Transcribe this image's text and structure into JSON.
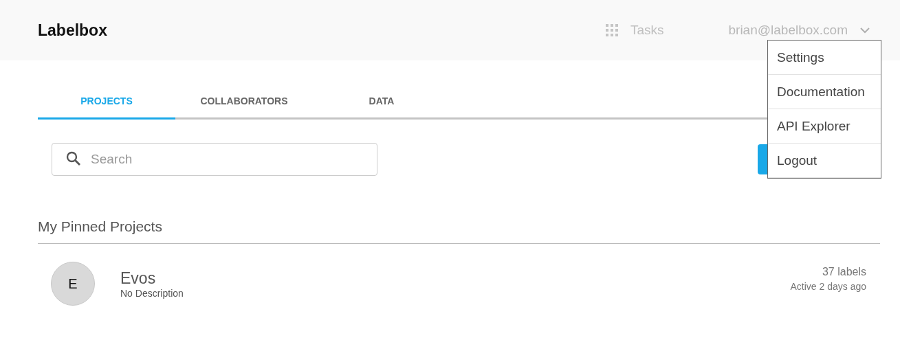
{
  "header": {
    "logo": "Labelbox",
    "tasks": "Tasks",
    "user_email": "brian@labelbox.com"
  },
  "user_menu": {
    "items": [
      {
        "label": "Settings"
      },
      {
        "label": "Documentation"
      },
      {
        "label": "API Explorer"
      },
      {
        "label": "Logout"
      }
    ]
  },
  "tabs": [
    {
      "label": "PROJECTS",
      "selected": true
    },
    {
      "label": "COLLABORATORS",
      "selected": false
    },
    {
      "label": "DATA",
      "selected": false
    }
  ],
  "search": {
    "placeholder": "Search"
  },
  "pinned_projects": {
    "title": "My Pinned Projects",
    "items": [
      {
        "initial": "E",
        "name": "Evos",
        "description": "No Description",
        "labels": "37 labels",
        "activity": "Active 2 days ago"
      }
    ]
  }
}
